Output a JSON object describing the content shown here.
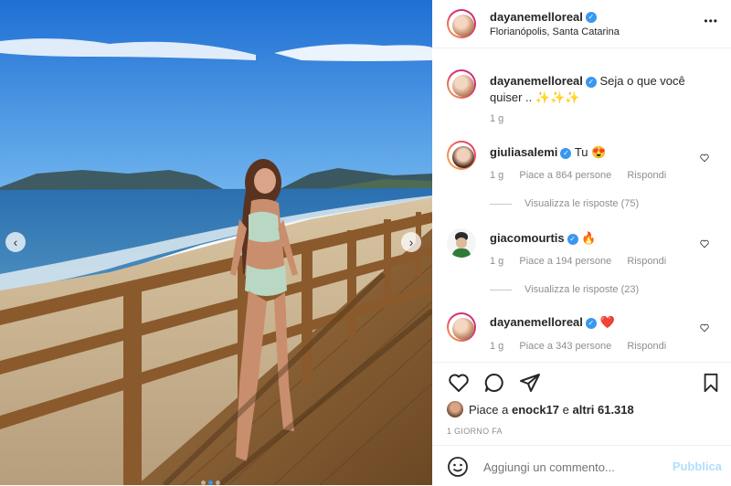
{
  "post": {
    "author": "dayanemelloreal",
    "location": "Florianópolis, Santa Catarina",
    "caption_line1": "Seja o que você",
    "caption_line2": "quiser ..",
    "caption_emoji": "✨✨✨",
    "caption_time": "1 g",
    "more_icon": "•••",
    "likes_prefix": "Piace a",
    "likes_user": "enock17",
    "likes_mid": "e",
    "likes_others": "altri 61.318",
    "posted_ago": "1 GIORNO FA",
    "comment_placeholder": "Aggiungi un commento...",
    "publish_label": "Pubblica"
  },
  "comments": [
    {
      "user": "giuliasalemi",
      "text": "Tu",
      "emoji": "😍",
      "time": "1 g",
      "likes": "Piace a 864 persone",
      "reply": "Rispondi",
      "replies": "Visualizza le risposte (75)"
    },
    {
      "user": "giacomourtis",
      "text": "",
      "emoji": "🔥",
      "time": "1 g",
      "likes": "Piace a 194 persone",
      "reply": "Rispondi",
      "replies": "Visualizza le risposte (23)"
    },
    {
      "user": "dayanemelloreal",
      "text": "",
      "emoji": "❤️",
      "time": "1 g",
      "likes": "Piace a 343 persone",
      "reply": "Rispondi"
    }
  ],
  "icons": {
    "like": "heart-icon",
    "comment": "comment-icon",
    "share": "paper-plane-icon",
    "save": "bookmark-icon",
    "emoji": "smiley-icon",
    "verified": "verified-badge-icon"
  },
  "colors": {
    "link": "#3897f0",
    "verified": "#3897f0",
    "muted": "#8e8e8e",
    "heart": "#ed4956"
  },
  "carousel": {
    "prev_glyph": "‹",
    "next_glyph": "›",
    "slide_count": 3,
    "active_slide": 2
  }
}
